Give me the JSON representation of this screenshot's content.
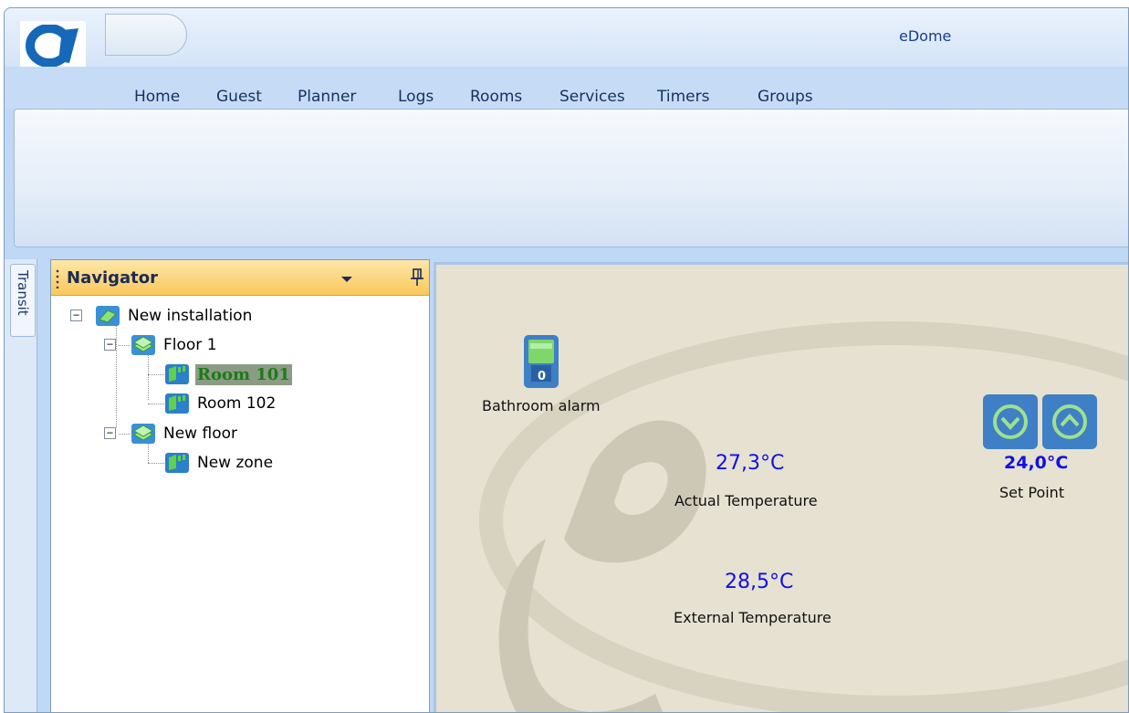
{
  "app": {
    "title": "eDome",
    "logo": "edome-logo-icon"
  },
  "menu": {
    "items": [
      {
        "label": "Home"
      },
      {
        "label": "Guest"
      },
      {
        "label": "Planner"
      },
      {
        "label": "Logs"
      },
      {
        "label": "Rooms"
      },
      {
        "label": "Services"
      },
      {
        "label": "Timers"
      },
      {
        "label": "Groups"
      }
    ]
  },
  "side_tabs": {
    "transit": "Transit"
  },
  "navigator": {
    "title": "Navigator",
    "tree": [
      {
        "label": "New installation",
        "icon": "installation-icon",
        "expanded": true
      },
      {
        "label": "Floor 1",
        "icon": "floor-icon",
        "expanded": true
      },
      {
        "label": "Room 101",
        "icon": "room-icon",
        "selected": true
      },
      {
        "label": "Room 102",
        "icon": "room-icon"
      },
      {
        "label": "New floor",
        "icon": "floor-icon",
        "expanded": true
      },
      {
        "label": "New zone",
        "icon": "room-icon"
      }
    ]
  },
  "room_view": {
    "bathroom_alarm": {
      "label": "Bathroom alarm",
      "icon": "alarm-switch-icon",
      "switch_text": "0"
    },
    "actual_temperature": {
      "value": "27,3°C",
      "label": "Actual Temperature"
    },
    "external_temperature": {
      "value": "28,5°C",
      "label": "External Temperature"
    },
    "set_point": {
      "value": "24,0°C",
      "label": "Set Point",
      "down_icon": "chevron-down-circle-icon",
      "up_icon": "chevron-up-circle-icon"
    }
  },
  "colors": {
    "accent_blue": "#1010e6",
    "selected_text": "#1f7a18",
    "navigator_header": "#f9c85c"
  }
}
